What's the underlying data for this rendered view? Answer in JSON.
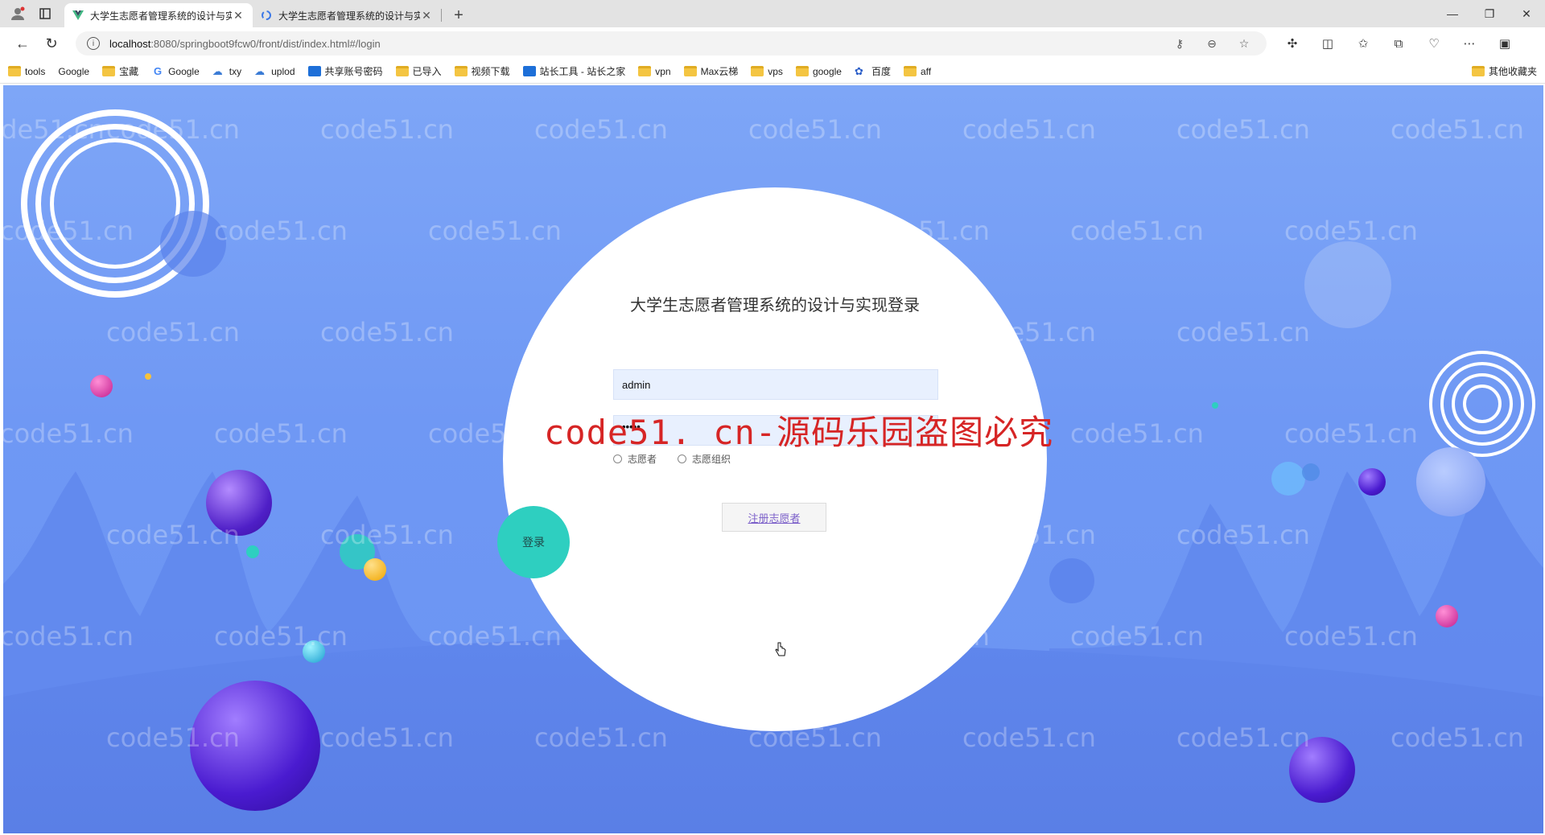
{
  "browser": {
    "tabs": [
      {
        "title": "大学生志愿者管理系统的设计与实",
        "active": true
      },
      {
        "title": "大学生志愿者管理系统的设计与实",
        "active": false
      }
    ],
    "url_host": "localhost",
    "url_path": ":8080/springboot9fcw0/front/dist/index.html#/login",
    "bookmarks": [
      "tools",
      "Google",
      "宝藏",
      "Google",
      "txy",
      "uplod",
      "共享账号密码",
      "已导入",
      "视频下载",
      "站长工具 - 站长之家",
      "vpn",
      "Max云梯",
      "vps",
      "google",
      "百度",
      "aff"
    ],
    "other_bookmarks": "其他收藏夹"
  },
  "login": {
    "title": "大学生志愿者管理系统的设计与实现登录",
    "username_value": "admin",
    "password_value": "•••••",
    "role_options": [
      "志愿者",
      "志愿组织"
    ],
    "register_label": "注册志愿者",
    "login_label": "登录"
  },
  "watermark": {
    "repeat_text": "code51.cn",
    "red_text": "code51. cn-源码乐园盗图必究"
  },
  "colors": {
    "page_bg": "#7ea6f7",
    "login_button": "#2ecfc0",
    "red_watermark": "#d62525"
  }
}
